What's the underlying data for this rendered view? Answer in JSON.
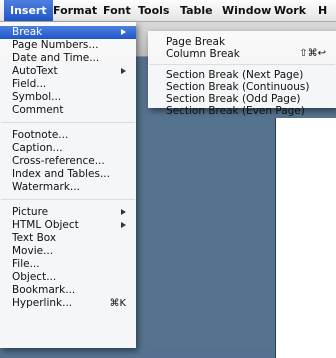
{
  "menubar": {
    "items": [
      "Insert",
      "Format",
      "Font",
      "Tools",
      "Table",
      "Window",
      "Work",
      "H"
    ]
  },
  "insert_menu": {
    "items": [
      {
        "label": "Break",
        "submenu": true,
        "highlighted": true
      },
      {
        "label": "Page Numbers..."
      },
      {
        "label": "Date and Time..."
      },
      {
        "label": "AutoText",
        "submenu": true
      },
      {
        "label": "Field..."
      },
      {
        "label": "Symbol..."
      },
      {
        "label": "Comment"
      },
      {
        "label": "Footnote..."
      },
      {
        "label": "Caption..."
      },
      {
        "label": "Cross-reference..."
      },
      {
        "label": "Index and Tables..."
      },
      {
        "label": "Watermark..."
      },
      {
        "label": "Picture",
        "submenu": true
      },
      {
        "label": "HTML Object",
        "submenu": true
      },
      {
        "label": "Text Box"
      },
      {
        "label": "Movie..."
      },
      {
        "label": "File..."
      },
      {
        "label": "Object..."
      },
      {
        "label": "Bookmark..."
      },
      {
        "label": "Hyperlink...",
        "shortcut": "⌘K"
      }
    ]
  },
  "break_submenu": {
    "items": [
      {
        "label": "Page Break"
      },
      {
        "label": "Column Break",
        "shortcut": "⇧⌘↩"
      },
      {
        "label": "Section Break (Next Page)"
      },
      {
        "label": "Section Break (Continuous)"
      },
      {
        "label": "Section Break (Odd Page)"
      },
      {
        "label": "Section Break (Even Page)"
      }
    ]
  },
  "colors": {
    "highlight": "#2a63d6",
    "background": "#55728f"
  }
}
